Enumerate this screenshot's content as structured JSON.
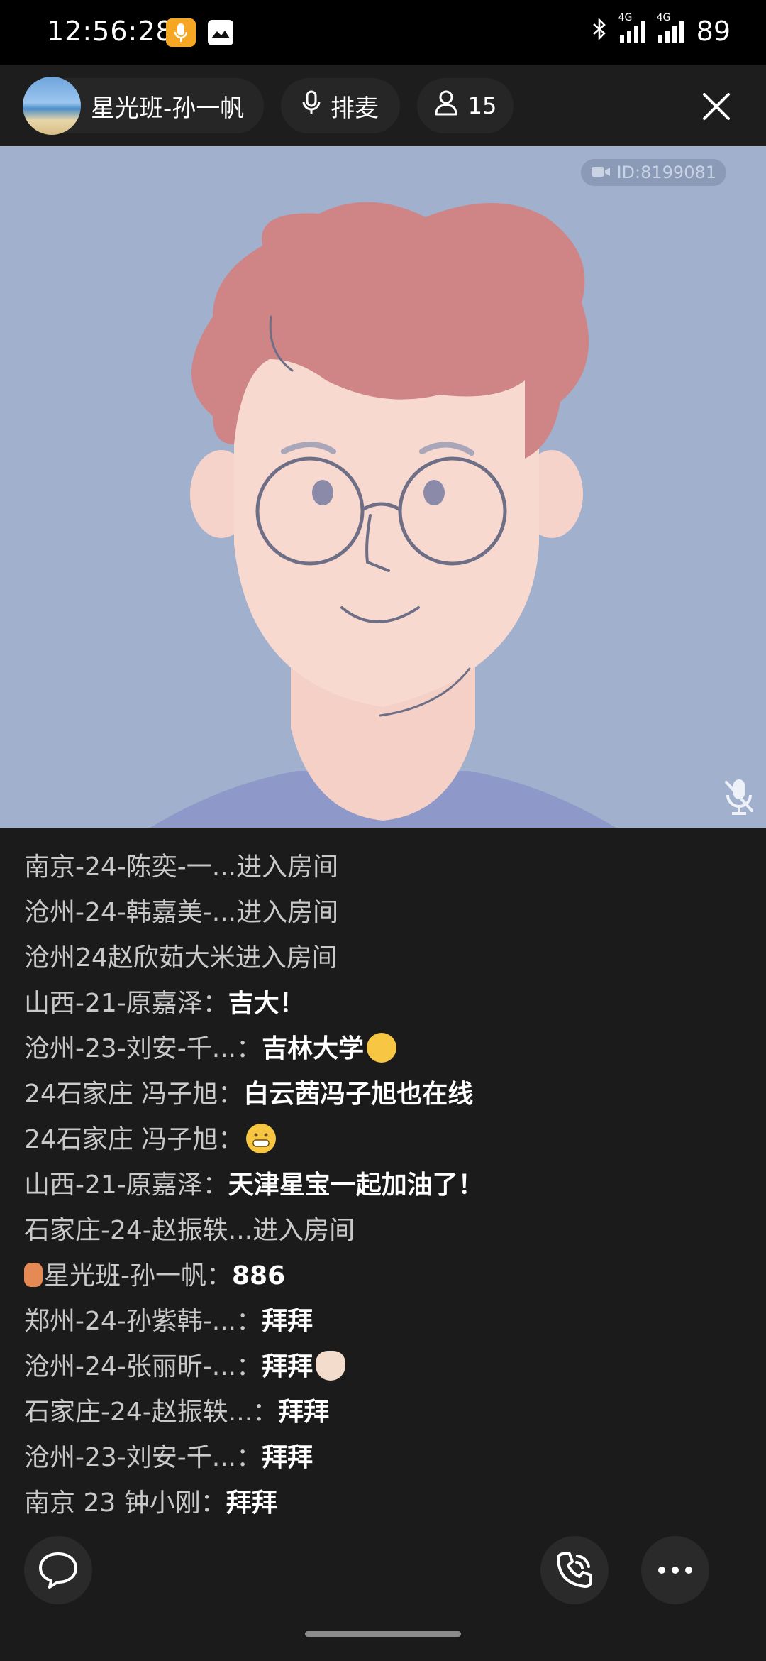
{
  "status_bar": {
    "time": "12:56:28",
    "battery": "89",
    "network_label": "4G",
    "icons": [
      "mic-recording-icon",
      "gallery-icon",
      "bluetooth-icon",
      "signal-icon",
      "battery-icon"
    ],
    "accent": "#f5a623"
  },
  "header": {
    "host_name": "星光班-孙一帆",
    "mic_queue_label": "排麦",
    "viewer_count": "15"
  },
  "video": {
    "room_id": "ID:8199081",
    "background": "#a1b1cd"
  },
  "chat": {
    "messages": [
      {
        "user": "南京-24-陈奕-一...进入房间",
        "text": ""
      },
      {
        "user": "沧州-24-韩嘉美-...进入房间",
        "text": ""
      },
      {
        "user": "沧州24赵欣茹大米进入房间",
        "text": ""
      },
      {
        "user": "山西-21-原嘉泽：",
        "text": "吉大！"
      },
      {
        "user": "沧州-23-刘安-千...：",
        "text": "吉林大学"
      },
      {
        "user": "24石家庄 冯子旭：",
        "text": "白云茜冯子旭也在线"
      },
      {
        "user": "24石家庄 冯子旭：",
        "text": ""
      },
      {
        "user": "山西-21-原嘉泽：",
        "text": "天津星宝一起加油了！"
      },
      {
        "user": "石家庄-24-赵振轶...进入房间",
        "text": ""
      },
      {
        "user": "星光班-孙一帆：",
        "text": "886"
      },
      {
        "user": "郑州-24-孙紫韩-...：",
        "text": "拜拜"
      },
      {
        "user": "沧州-24-张丽昕-...：",
        "text": "拜拜"
      },
      {
        "user": "石家庄-24-赵振轶...：",
        "text": "拜拜"
      },
      {
        "user": "沧州-23-刘安-千...：",
        "text": "拜拜"
      },
      {
        "user": "南京 23 钟小刚：",
        "text": "拜拜"
      }
    ]
  }
}
